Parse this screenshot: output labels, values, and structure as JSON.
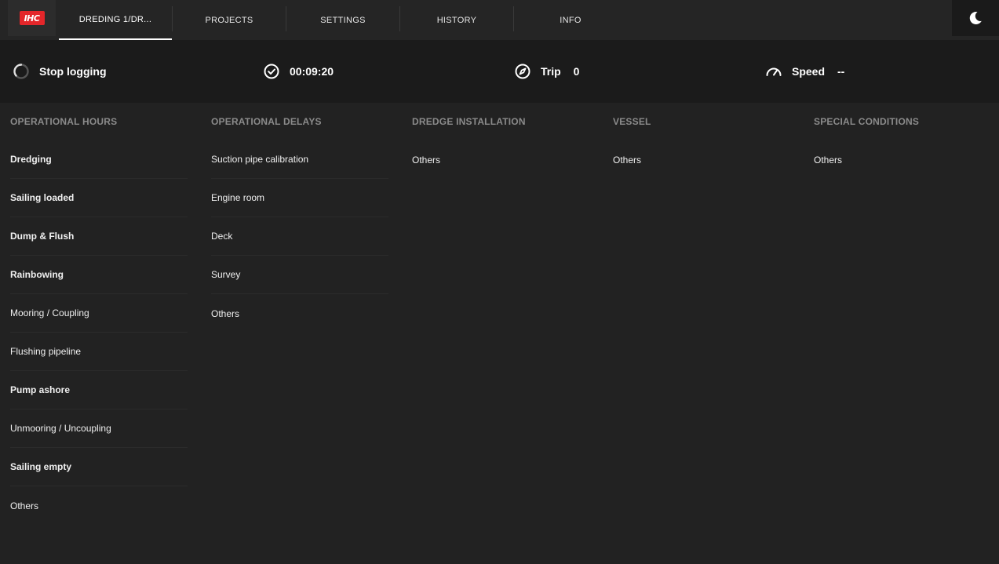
{
  "nav": {
    "logo_text": "IHC",
    "tabs": [
      {
        "label": "DREDING 1/DR...",
        "active": true
      },
      {
        "label": "PROJECTS",
        "active": false
      },
      {
        "label": "SETTINGS",
        "active": false
      },
      {
        "label": "HISTORY",
        "active": false
      },
      {
        "label": "INFO",
        "active": false
      }
    ],
    "theme_icon": "moon-icon"
  },
  "status": {
    "logging_label": "Stop logging",
    "timer": "00:09:20",
    "trip_label": "Trip",
    "trip_value": "0",
    "speed_label": "Speed",
    "speed_value": "--"
  },
  "columns": [
    {
      "header": "OPERATIONAL HOURS",
      "items": [
        {
          "label": "Dredging",
          "bold": true
        },
        {
          "label": "Sailing loaded",
          "bold": true
        },
        {
          "label": "Dump & Flush",
          "bold": true
        },
        {
          "label": "Rainbowing",
          "bold": true
        },
        {
          "label": "Mooring / Coupling",
          "bold": false
        },
        {
          "label": "Flushing pipeline",
          "bold": false
        },
        {
          "label": "Pump ashore",
          "bold": true
        },
        {
          "label": "Unmooring / Uncoupling",
          "bold": false
        },
        {
          "label": "Sailing empty",
          "bold": true
        },
        {
          "label": "Others",
          "bold": false
        }
      ]
    },
    {
      "header": "OPERATIONAL DELAYS",
      "items": [
        {
          "label": "Suction pipe calibration",
          "bold": false
        },
        {
          "label": "Engine room",
          "bold": false
        },
        {
          "label": "Deck",
          "bold": false
        },
        {
          "label": "Survey",
          "bold": false
        },
        {
          "label": "Others",
          "bold": false
        }
      ]
    },
    {
      "header": "DREDGE INSTALLATION",
      "items": [
        {
          "label": "Others",
          "bold": false
        }
      ]
    },
    {
      "header": "VESSEL",
      "items": [
        {
          "label": "Others",
          "bold": false
        }
      ]
    },
    {
      "header": "SPECIAL CONDITIONS",
      "items": [
        {
          "label": "Others",
          "bold": false
        }
      ]
    }
  ],
  "colors": {
    "accent": "#e3262a",
    "background": "#222222",
    "header_text": "#8b8b8b"
  }
}
